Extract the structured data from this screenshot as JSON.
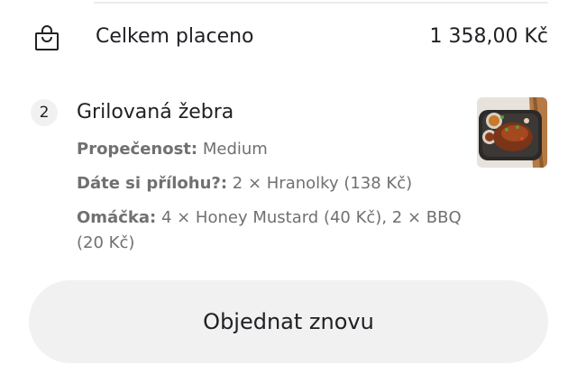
{
  "summary": {
    "icon": "shopping-bag-icon",
    "label": "Celkem placeno",
    "value": "1 358,00 Kč"
  },
  "item": {
    "quantity": "2",
    "name": "Grilovaná žebra",
    "image": "grilled-ribs-photo",
    "options": [
      {
        "label": "Propečenost:",
        "value": "Medium"
      },
      {
        "label": "Dáte si přílohu?:",
        "value": "2 × Hranolky (138 Kč)"
      },
      {
        "label": "Omáčka:",
        "value": "4 × Honey Mustard (40 Kč), 2 × BBQ (20 Kč)"
      }
    ]
  },
  "reorder_button": {
    "label": "Objednat znovu"
  },
  "colors": {
    "text": "#202125",
    "muted": "#707070",
    "button_bg": "#f1f1f1"
  }
}
